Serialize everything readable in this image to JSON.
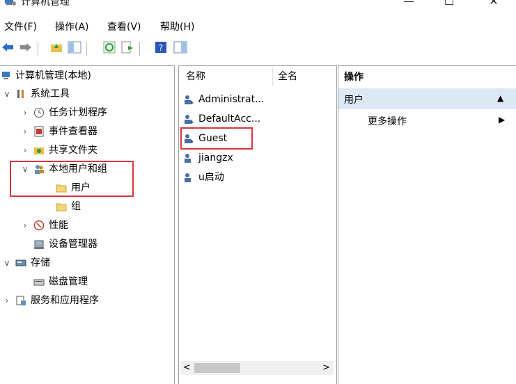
{
  "window": {
    "title": "计算机管理",
    "minimize_glyph": "—",
    "maximize_glyph": "☐",
    "close_glyph": "✕"
  },
  "menu": [
    "文件(F)",
    "操作(A)",
    "查看(V)",
    "帮助(H)"
  ],
  "tree": {
    "root": "计算机管理(本地)",
    "system_tools": "系统工具",
    "task_scheduler": "任务计划程序",
    "event_viewer": "事件查看器",
    "shared_folders": "共享文件夹",
    "local_users_groups": "本地用户和组",
    "users": "用户",
    "groups": "组",
    "performance": "性能",
    "device_manager": "设备管理器",
    "storage": "存储",
    "disk_management": "磁盘管理",
    "services_apps": "服务和应用程序"
  },
  "list": {
    "columns": [
      "名称",
      "全名"
    ],
    "rows": [
      "Administrat...",
      "DefaultAcc...",
      "Guest",
      "jiangzx",
      "u启动"
    ]
  },
  "actions": {
    "title": "操作",
    "section": "用户",
    "more": "更多操作"
  },
  "scroll": {
    "left_arrow": "<",
    "right_arrow": ">"
  },
  "colors": {
    "highlight_border": "#d9363e",
    "section_bg": "#dde8f5"
  }
}
